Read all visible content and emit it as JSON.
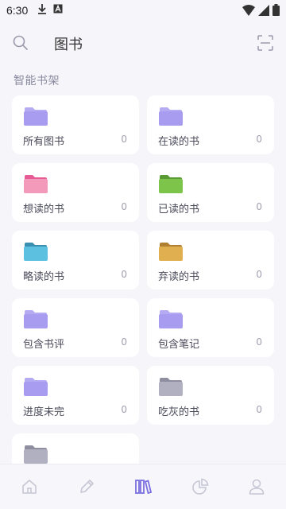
{
  "status_bar": {
    "time": "6:30"
  },
  "header": {
    "title": "图书"
  },
  "section": {
    "title": "智能书架"
  },
  "shelves": [
    {
      "label": "所有图书",
      "count": "0",
      "color": "#a79cf0"
    },
    {
      "label": "在读的书",
      "count": "0",
      "color": "#a79cf0"
    },
    {
      "label": "想读的书",
      "count": "0",
      "color": "#f39abb"
    },
    {
      "label": "已读的书",
      "count": "0",
      "color": "#7cc44a"
    },
    {
      "label": "略读的书",
      "count": "0",
      "color": "#5cc0e0"
    },
    {
      "label": "弃读的书",
      "count": "0",
      "color": "#e0b050"
    },
    {
      "label": "包含书评",
      "count": "0",
      "color": "#a79cf0"
    },
    {
      "label": "包含笔记",
      "count": "0",
      "color": "#a79cf0"
    },
    {
      "label": "进度未完",
      "count": "0",
      "color": "#a79cf0"
    },
    {
      "label": "吃灰的书",
      "count": "0",
      "color": "#b0b0c0"
    },
    {
      "label": "",
      "count": "",
      "color": "#b0b0c0"
    }
  ],
  "bottom_nav": {
    "items": [
      {
        "icon": "home-icon",
        "active": false
      },
      {
        "icon": "pencil-icon",
        "active": false
      },
      {
        "icon": "books-icon",
        "active": true
      },
      {
        "icon": "pie-chart-icon",
        "active": false
      },
      {
        "icon": "user-icon",
        "active": false
      }
    ],
    "active_color": "#7a6fe0",
    "inactive_color": "#c6c6d4"
  }
}
